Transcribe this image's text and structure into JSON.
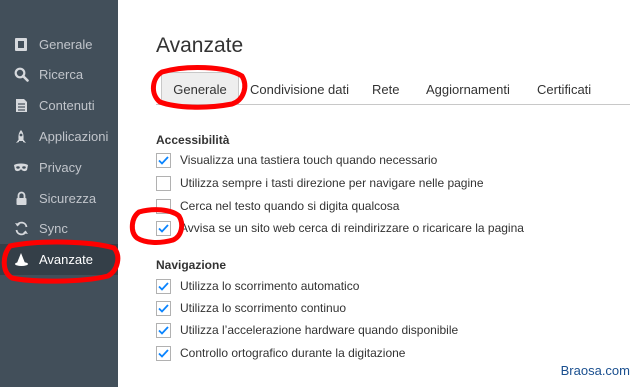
{
  "sidebar": {
    "items": [
      {
        "label": "Generale",
        "icon": "page-icon",
        "active": false
      },
      {
        "label": "Ricerca",
        "icon": "search-icon",
        "active": false
      },
      {
        "label": "Contenuti",
        "icon": "document-icon",
        "active": false
      },
      {
        "label": "Applicazioni",
        "icon": "rocket-icon",
        "active": false
      },
      {
        "label": "Privacy",
        "icon": "mask-icon",
        "active": false
      },
      {
        "label": "Sicurezza",
        "icon": "lock-icon",
        "active": false
      },
      {
        "label": "Sync",
        "icon": "sync-icon",
        "active": false
      },
      {
        "label": "Avanzate",
        "icon": "wizard-hat-icon",
        "active": true
      }
    ]
  },
  "main": {
    "title": "Avanzate",
    "tabs": [
      {
        "label": "Generale",
        "active": true
      },
      {
        "label": "Condivisione dati",
        "active": false
      },
      {
        "label": "Rete",
        "active": false
      },
      {
        "label": "Aggiornamenti",
        "active": false
      },
      {
        "label": "Certificati",
        "active": false
      }
    ],
    "accessibility": {
      "heading": "Accessibilità",
      "options": [
        {
          "label": "Visualizza una tastiera touch quando necessario",
          "checked": true
        },
        {
          "label": "Utilizza sempre i tasti direzione per navigare nelle pagine",
          "checked": false
        },
        {
          "label": "Cerca nel testo quando si digita qualcosa",
          "checked": false
        },
        {
          "label": "Avvisa se un sito web cerca di reindirizzare o ricaricare la pagina",
          "checked": true
        }
      ]
    },
    "navigation": {
      "heading": "Navigazione",
      "options": [
        {
          "label": "Utilizza lo scorrimento automatico",
          "checked": true
        },
        {
          "label": "Utilizza lo scorrimento continuo",
          "checked": true
        },
        {
          "label": "Utilizza l’accelerazione hardware quando disponibile",
          "checked": true
        },
        {
          "label": "Controllo ortografico durante la digitazione",
          "checked": true
        }
      ]
    }
  },
  "watermark": "Braosa.com",
  "colors": {
    "sidebar": "#424f5a",
    "sidebar_active": "#343f48",
    "checkmark": "#0a84ff",
    "annotation": "#ff0000"
  }
}
